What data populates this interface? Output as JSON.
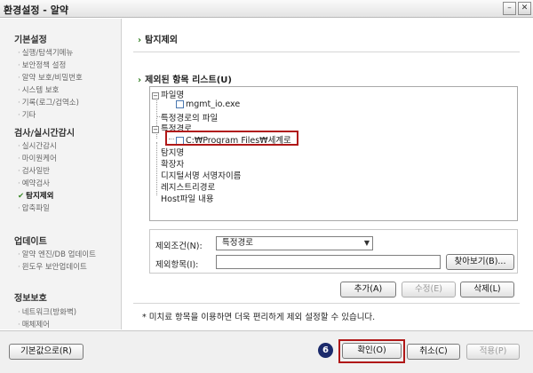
{
  "window": {
    "title": "환경설정 - 알약",
    "min_label": "–",
    "close_label": "✕"
  },
  "sidebar": {
    "sections": [
      {
        "title": "기본설정",
        "items": [
          "실행/탐색기메뉴",
          "보안정책 설정",
          "알약 보호/비밀번호",
          "시스템 보호",
          "기록(로그/검역소)",
          "기타"
        ]
      },
      {
        "title": "검사/실시간감시",
        "items": [
          "실시간감시",
          "마이원케어",
          "검사일반",
          "예약검사",
          "탐지제외",
          "압축파일"
        ],
        "active_item": "탐지제외"
      },
      {
        "title": "업데이트",
        "items": [
          "알약 엔진/DB 업데이트",
          "윈도우 보안업데이트"
        ]
      },
      {
        "title": "정보보호",
        "items": [
          "네트워크(방화벽)",
          "매체제어"
        ]
      }
    ]
  },
  "main": {
    "section_title": "탐지제외",
    "list_title": "제외된 항목 리스트(U)",
    "tree": {
      "file_name_group": "파일명",
      "file_name_item": "mgmt_io.exe",
      "specific_path_file": "특정경로의 파일",
      "specific_path_group": "특정경로",
      "specific_path_item": "C:₩Program Files₩세계로",
      "detection_name": "탐지명",
      "extension": "확장자",
      "digital_signer": "디지털서명 서명자이름",
      "registry_path": "레지스트리경로",
      "host_file": "Host파일 내용"
    },
    "form": {
      "condition_label": "제외조건(N):",
      "condition_value": "특정경로",
      "item_label": "제외항목(I):",
      "item_value": "",
      "browse_button": "찾아보기(B)..."
    },
    "actions": {
      "add": "추가(A)",
      "edit": "수정(E)",
      "delete": "삭제(L)"
    },
    "note": "*  미치료 항목을 이용하면 더욱 편리하게 제외 설정할 수 있습니다."
  },
  "footer": {
    "defaults_button": "기본값으로(R)",
    "ok_button": "확인(O)",
    "cancel_button": "취소(C)",
    "apply_button": "적용(P)",
    "step_number": "6"
  },
  "colors": {
    "accent_green": "#2e7d1f",
    "highlight_red": "#b01818",
    "badge_navy": "#1b2a6b"
  }
}
